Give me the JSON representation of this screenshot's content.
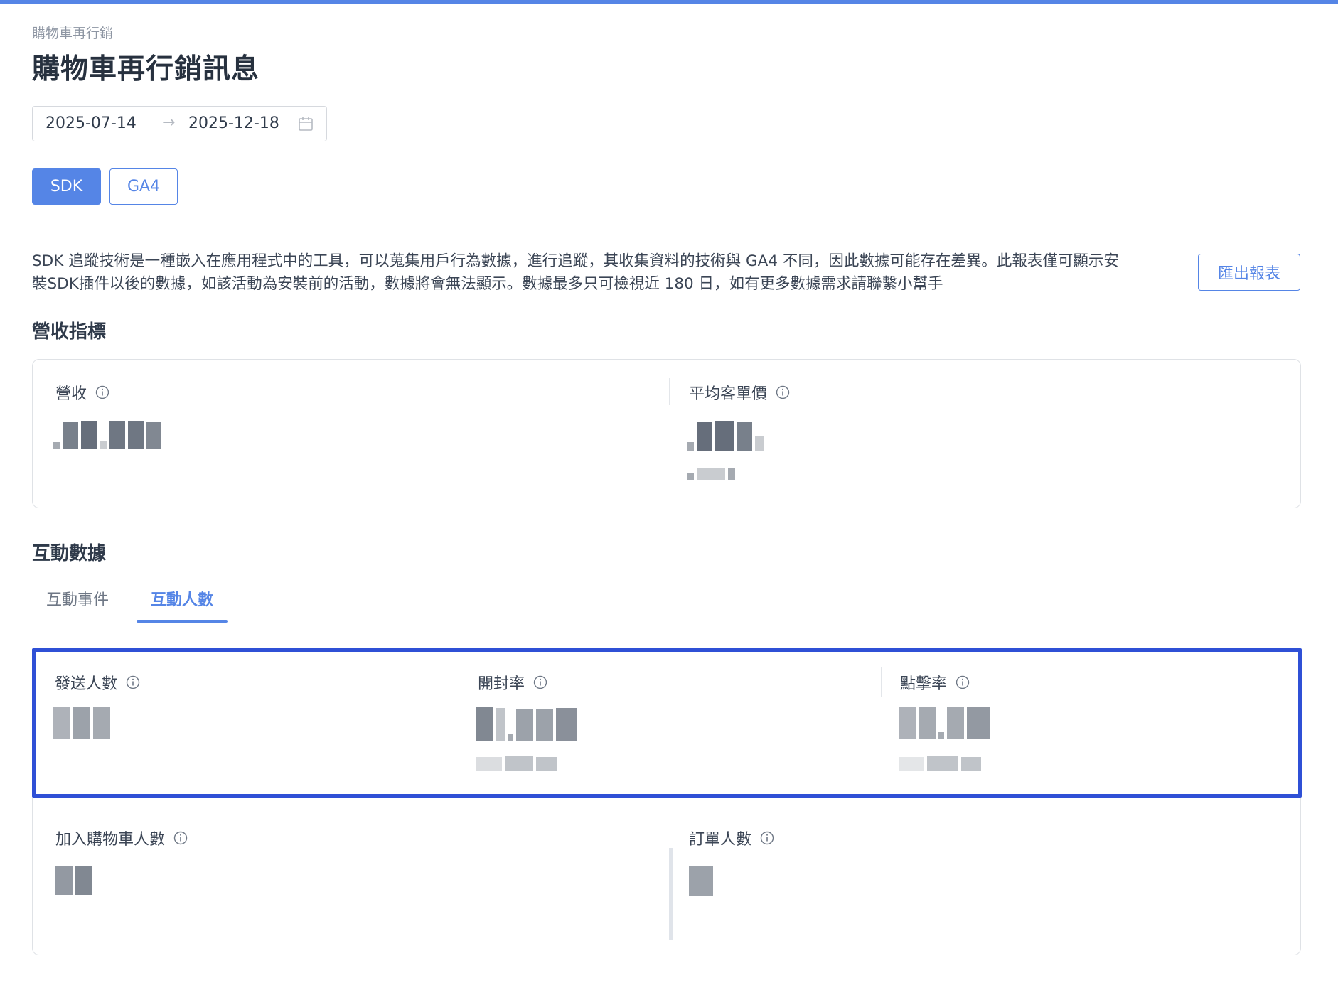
{
  "header": {
    "breadcrumb": "購物車再行銷",
    "title": "購物車再行銷訊息"
  },
  "date_range": {
    "start": "2025-07-14",
    "arrow": "→",
    "end": "2025-12-18"
  },
  "source_toggle": {
    "sdk_label": "SDK",
    "ga4_label": "GA4",
    "selected": "SDK"
  },
  "description": "SDK 追蹤技術是一種嵌入在應用程式中的工具，可以蒐集用戶行為數據，進行追蹤，其收集資料的技術與 GA4 不同，因此數據可能存在差異。此報表僅可顯示安裝SDK插件以後的數據，如該活動為安裝前的活動，數據將會無法顯示。數據最多只可檢視近 180 日，如有更多數據需求請聯繫小幫手",
  "export_label": "匯出報表",
  "revenue_section": {
    "title": "營收指標",
    "metrics": [
      {
        "label": "營收"
      },
      {
        "label": "平均客單價"
      }
    ]
  },
  "interaction_section": {
    "title": "互動數據",
    "tabs": [
      {
        "label": "互動事件",
        "active": false
      },
      {
        "label": "互動人數",
        "active": true
      }
    ],
    "highlight_metrics": [
      {
        "label": "發送人數"
      },
      {
        "label": "開封率"
      },
      {
        "label": "點擊率"
      }
    ],
    "bottom_metrics": [
      {
        "label": "加入購物車人數"
      },
      {
        "label": "訂單人數"
      }
    ]
  },
  "colors": {
    "accent": "#5585e6",
    "highlight_border": "#2f50d6",
    "text": "#2f3a4a"
  }
}
